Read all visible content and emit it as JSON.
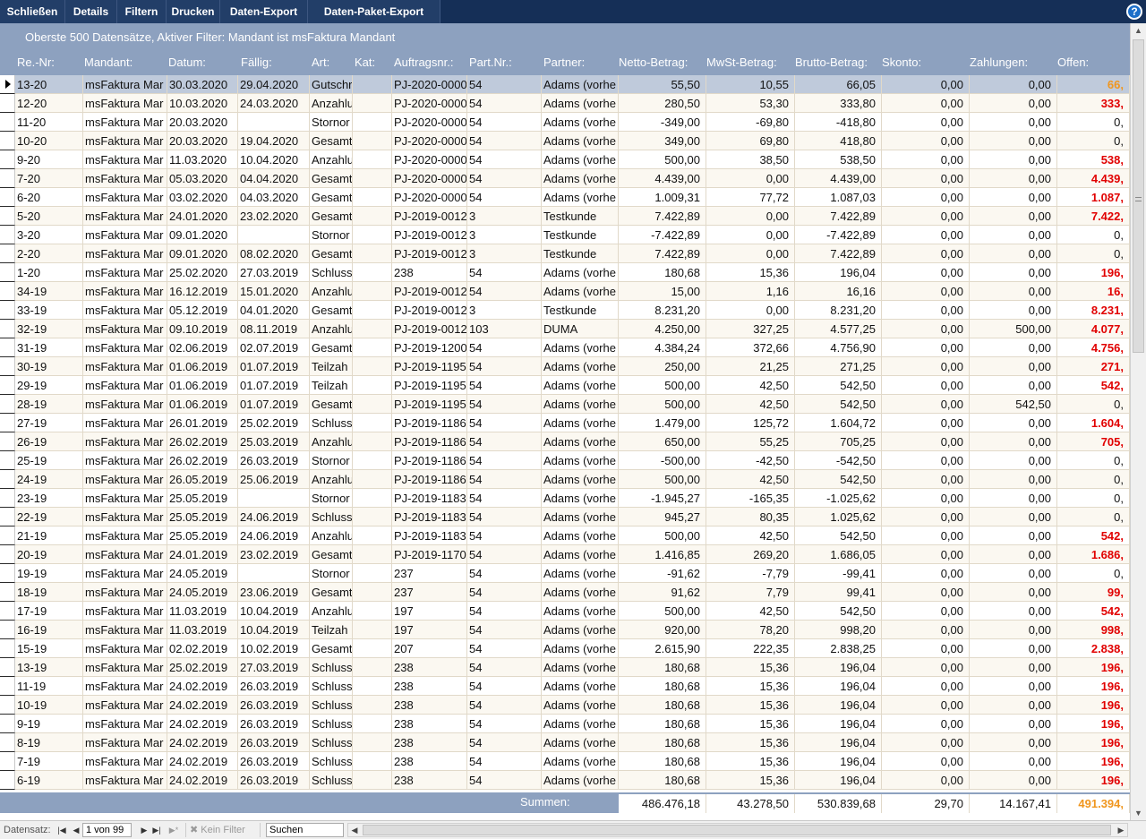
{
  "toolbar": {
    "buttons": [
      {
        "label": "Schließen"
      },
      {
        "label": "Details"
      },
      {
        "label": "Filtern"
      },
      {
        "label": "Drucken"
      },
      {
        "label": "Daten-Export"
      },
      {
        "label": "Daten-Paket-Export"
      }
    ],
    "help": "?"
  },
  "filter_text": "Oberste 500 Datensätze, Aktiver Filter:  Mandant  ist  msFaktura Mandant",
  "columns": [
    "Re.-Nr:",
    "Mandant:",
    "Datum:",
    "Fällig:",
    "Art:",
    "Kat:",
    "Auftragsnr.:",
    "Part.Nr.:",
    "Partner:",
    "Netto-Betrag:",
    "MwSt-Betrag:",
    "Brutto-Betrag:",
    "Skonto:",
    "Zahlungen:",
    "Offen:"
  ],
  "rows": [
    [
      "13-20",
      "msFaktura Mar",
      "30.03.2020",
      "29.04.2020",
      "Gutschr",
      "",
      "PJ-2020-0000",
      "54",
      "Adams (vorhe",
      "55,50",
      "10,55",
      "66,05",
      "0,00",
      "0,00",
      "66,"
    ],
    [
      "12-20",
      "msFaktura Mar",
      "10.03.2020",
      "24.03.2020",
      "Anzahlu",
      "",
      "PJ-2020-0000",
      "54",
      "Adams (vorhe",
      "280,50",
      "53,30",
      "333,80",
      "0,00",
      "0,00",
      "333,"
    ],
    [
      "11-20",
      "msFaktura Mar",
      "20.03.2020",
      "",
      "Stornor",
      "",
      "PJ-2020-0000",
      "54",
      "Adams (vorhe",
      "-349,00",
      "-69,80",
      "-418,80",
      "0,00",
      "0,00",
      "0,"
    ],
    [
      "10-20",
      "msFaktura Mar",
      "20.03.2020",
      "19.04.2020",
      "Gesamt",
      "",
      "PJ-2020-0000",
      "54",
      "Adams (vorhe",
      "349,00",
      "69,80",
      "418,80",
      "0,00",
      "0,00",
      "0,"
    ],
    [
      "9-20",
      "msFaktura Mar",
      "11.03.2020",
      "10.04.2020",
      "Anzahlu",
      "",
      "PJ-2020-0000",
      "54",
      "Adams (vorhe",
      "500,00",
      "38,50",
      "538,50",
      "0,00",
      "0,00",
      "538,"
    ],
    [
      "7-20",
      "msFaktura Mar",
      "05.03.2020",
      "04.04.2020",
      "Gesamt",
      "",
      "PJ-2020-0000",
      "54",
      "Adams (vorhe",
      "4.439,00",
      "0,00",
      "4.439,00",
      "0,00",
      "0,00",
      "4.439,"
    ],
    [
      "6-20",
      "msFaktura Mar",
      "03.02.2020",
      "04.03.2020",
      "Gesamt",
      "",
      "PJ-2020-0000",
      "54",
      "Adams (vorhe",
      "1.009,31",
      "77,72",
      "1.087,03",
      "0,00",
      "0,00",
      "1.087,"
    ],
    [
      "5-20",
      "msFaktura Mar",
      "24.01.2020",
      "23.02.2020",
      "Gesamt",
      "",
      "PJ-2019-0012",
      "3",
      "Testkunde",
      "7.422,89",
      "0,00",
      "7.422,89",
      "0,00",
      "0,00",
      "7.422,"
    ],
    [
      "3-20",
      "msFaktura Mar",
      "09.01.2020",
      "",
      "Stornor",
      "",
      "PJ-2019-0012",
      "3",
      "Testkunde",
      "-7.422,89",
      "0,00",
      "-7.422,89",
      "0,00",
      "0,00",
      "0,"
    ],
    [
      "2-20",
      "msFaktura Mar",
      "09.01.2020",
      "08.02.2020",
      "Gesamt",
      "",
      "PJ-2019-0012",
      "3",
      "Testkunde",
      "7.422,89",
      "0,00",
      "7.422,89",
      "0,00",
      "0,00",
      "0,"
    ],
    [
      "1-20",
      "msFaktura Mar",
      "25.02.2020",
      "27.03.2019",
      "Schluss",
      "",
      "238",
      "54",
      "Adams (vorhe",
      "180,68",
      "15,36",
      "196,04",
      "0,00",
      "0,00",
      "196,"
    ],
    [
      "34-19",
      "msFaktura Mar",
      "16.12.2019",
      "15.01.2020",
      "Anzahlu",
      "",
      "PJ-2019-0012",
      "54",
      "Adams (vorhe",
      "15,00",
      "1,16",
      "16,16",
      "0,00",
      "0,00",
      "16,"
    ],
    [
      "33-19",
      "msFaktura Mar",
      "05.12.2019",
      "04.01.2020",
      "Gesamt",
      "",
      "PJ-2019-0012",
      "3",
      "Testkunde",
      "8.231,20",
      "0,00",
      "8.231,20",
      "0,00",
      "0,00",
      "8.231,"
    ],
    [
      "32-19",
      "msFaktura Mar",
      "09.10.2019",
      "08.11.2019",
      "Anzahlu",
      "",
      "PJ-2019-0012",
      "103",
      "DUMA",
      "4.250,00",
      "327,25",
      "4.577,25",
      "0,00",
      "500,00",
      "4.077,"
    ],
    [
      "31-19",
      "msFaktura Mar",
      "02.06.2019",
      "02.07.2019",
      "Gesamt",
      "",
      "PJ-2019-1200",
      "54",
      "Adams (vorhe",
      "4.384,24",
      "372,66",
      "4.756,90",
      "0,00",
      "0,00",
      "4.756,"
    ],
    [
      "30-19",
      "msFaktura Mar",
      "01.06.2019",
      "01.07.2019",
      "Teilzah",
      "",
      "PJ-2019-1195",
      "54",
      "Adams (vorhe",
      "250,00",
      "21,25",
      "271,25",
      "0,00",
      "0,00",
      "271,"
    ],
    [
      "29-19",
      "msFaktura Mar",
      "01.06.2019",
      "01.07.2019",
      "Teilzah",
      "",
      "PJ-2019-1195",
      "54",
      "Adams (vorhe",
      "500,00",
      "42,50",
      "542,50",
      "0,00",
      "0,00",
      "542,"
    ],
    [
      "28-19",
      "msFaktura Mar",
      "01.06.2019",
      "01.07.2019",
      "Gesamt",
      "",
      "PJ-2019-1195",
      "54",
      "Adams (vorhe",
      "500,00",
      "42,50",
      "542,50",
      "0,00",
      "542,50",
      "0,"
    ],
    [
      "27-19",
      "msFaktura Mar",
      "26.01.2019",
      "25.02.2019",
      "Schluss",
      "",
      "PJ-2019-1186",
      "54",
      "Adams (vorhe",
      "1.479,00",
      "125,72",
      "1.604,72",
      "0,00",
      "0,00",
      "1.604,"
    ],
    [
      "26-19",
      "msFaktura Mar",
      "26.02.2019",
      "25.03.2019",
      "Anzahlu",
      "",
      "PJ-2019-1186",
      "54",
      "Adams (vorhe",
      "650,00",
      "55,25",
      "705,25",
      "0,00",
      "0,00",
      "705,"
    ],
    [
      "25-19",
      "msFaktura Mar",
      "26.02.2019",
      "26.03.2019",
      "Stornor",
      "",
      "PJ-2019-1186",
      "54",
      "Adams (vorhe",
      "-500,00",
      "-42,50",
      "-542,50",
      "0,00",
      "0,00",
      "0,"
    ],
    [
      "24-19",
      "msFaktura Mar",
      "26.05.2019",
      "25.06.2019",
      "Anzahlu",
      "",
      "PJ-2019-1186",
      "54",
      "Adams (vorhe",
      "500,00",
      "42,50",
      "542,50",
      "0,00",
      "0,00",
      "0,"
    ],
    [
      "23-19",
      "msFaktura Mar",
      "25.05.2019",
      "",
      "Stornor",
      "",
      "PJ-2019-1183",
      "54",
      "Adams (vorhe",
      "-1.945,27",
      "-165,35",
      "-1.025,62",
      "0,00",
      "0,00",
      "0,"
    ],
    [
      "22-19",
      "msFaktura Mar",
      "25.05.2019",
      "24.06.2019",
      "Schluss",
      "",
      "PJ-2019-1183",
      "54",
      "Adams (vorhe",
      "945,27",
      "80,35",
      "1.025,62",
      "0,00",
      "0,00",
      "0,"
    ],
    [
      "21-19",
      "msFaktura Mar",
      "25.05.2019",
      "24.06.2019",
      "Anzahlu",
      "",
      "PJ-2019-1183",
      "54",
      "Adams (vorhe",
      "500,00",
      "42,50",
      "542,50",
      "0,00",
      "0,00",
      "542,"
    ],
    [
      "20-19",
      "msFaktura Mar",
      "24.01.2019",
      "23.02.2019",
      "Gesamt",
      "",
      "PJ-2019-1170",
      "54",
      "Adams (vorhe",
      "1.416,85",
      "269,20",
      "1.686,05",
      "0,00",
      "0,00",
      "1.686,"
    ],
    [
      "19-19",
      "msFaktura Mar",
      "24.05.2019",
      "",
      "Stornor",
      "",
      "237",
      "54",
      "Adams (vorhe",
      "-91,62",
      "-7,79",
      "-99,41",
      "0,00",
      "0,00",
      "0,"
    ],
    [
      "18-19",
      "msFaktura Mar",
      "24.05.2019",
      "23.06.2019",
      "Gesamt",
      "",
      "237",
      "54",
      "Adams (vorhe",
      "91,62",
      "7,79",
      "99,41",
      "0,00",
      "0,00",
      "99,"
    ],
    [
      "17-19",
      "msFaktura Mar",
      "11.03.2019",
      "10.04.2019",
      "Anzahlu",
      "",
      "197",
      "54",
      "Adams (vorhe",
      "500,00",
      "42,50",
      "542,50",
      "0,00",
      "0,00",
      "542,"
    ],
    [
      "16-19",
      "msFaktura Mar",
      "11.03.2019",
      "10.04.2019",
      "Teilzah",
      "",
      "197",
      "54",
      "Adams (vorhe",
      "920,00",
      "78,20",
      "998,20",
      "0,00",
      "0,00",
      "998,"
    ],
    [
      "15-19",
      "msFaktura Mar",
      "02.02.2019",
      "10.02.2019",
      "Gesamt",
      "",
      "207",
      "54",
      "Adams (vorhe",
      "2.615,90",
      "222,35",
      "2.838,25",
      "0,00",
      "0,00",
      "2.838,"
    ],
    [
      "13-19",
      "msFaktura Mar",
      "25.02.2019",
      "27.03.2019",
      "Schluss",
      "",
      "238",
      "54",
      "Adams (vorhe",
      "180,68",
      "15,36",
      "196,04",
      "0,00",
      "0,00",
      "196,"
    ],
    [
      "11-19",
      "msFaktura Mar",
      "24.02.2019",
      "26.03.2019",
      "Schluss",
      "",
      "238",
      "54",
      "Adams (vorhe",
      "180,68",
      "15,36",
      "196,04",
      "0,00",
      "0,00",
      "196,"
    ],
    [
      "10-19",
      "msFaktura Mar",
      "24.02.2019",
      "26.03.2019",
      "Schluss",
      "",
      "238",
      "54",
      "Adams (vorhe",
      "180,68",
      "15,36",
      "196,04",
      "0,00",
      "0,00",
      "196,"
    ],
    [
      "9-19",
      "msFaktura Mar",
      "24.02.2019",
      "26.03.2019",
      "Schluss",
      "",
      "238",
      "54",
      "Adams (vorhe",
      "180,68",
      "15,36",
      "196,04",
      "0,00",
      "0,00",
      "196,"
    ],
    [
      "8-19",
      "msFaktura Mar",
      "24.02.2019",
      "26.03.2019",
      "Schluss",
      "",
      "238",
      "54",
      "Adams (vorhe",
      "180,68",
      "15,36",
      "196,04",
      "0,00",
      "0,00",
      "196,"
    ],
    [
      "7-19",
      "msFaktura Mar",
      "24.02.2019",
      "26.03.2019",
      "Schluss",
      "",
      "238",
      "54",
      "Adams (vorhe",
      "180,68",
      "15,36",
      "196,04",
      "0,00",
      "0,00",
      "196,"
    ],
    [
      "6-19",
      "msFaktura Mar",
      "24.02.2019",
      "26.03.2019",
      "Schluss",
      "",
      "238",
      "54",
      "Adams (vorhe",
      "180,68",
      "15,36",
      "196,04",
      "0,00",
      "0,00",
      "196,"
    ]
  ],
  "sums": {
    "label": "Summen:",
    "netto": "486.476,18",
    "mwst": "43.278,50",
    "brutto": "530.839,68",
    "skonto": "29,70",
    "zahlungen": "14.167,41",
    "offen": "491.394,"
  },
  "navigation": {
    "label": "Datensatz:",
    "position": "1 von 99",
    "filter_label": "Kein Filter",
    "search_placeholder": "Suchen"
  },
  "colors": {
    "toolbar_bg": "#152f57",
    "header_bg": "#8da1bf",
    "open_amount_red": "#e10000",
    "open_amount_orange": "#f0961e",
    "selected_row": "#bfcadb"
  }
}
